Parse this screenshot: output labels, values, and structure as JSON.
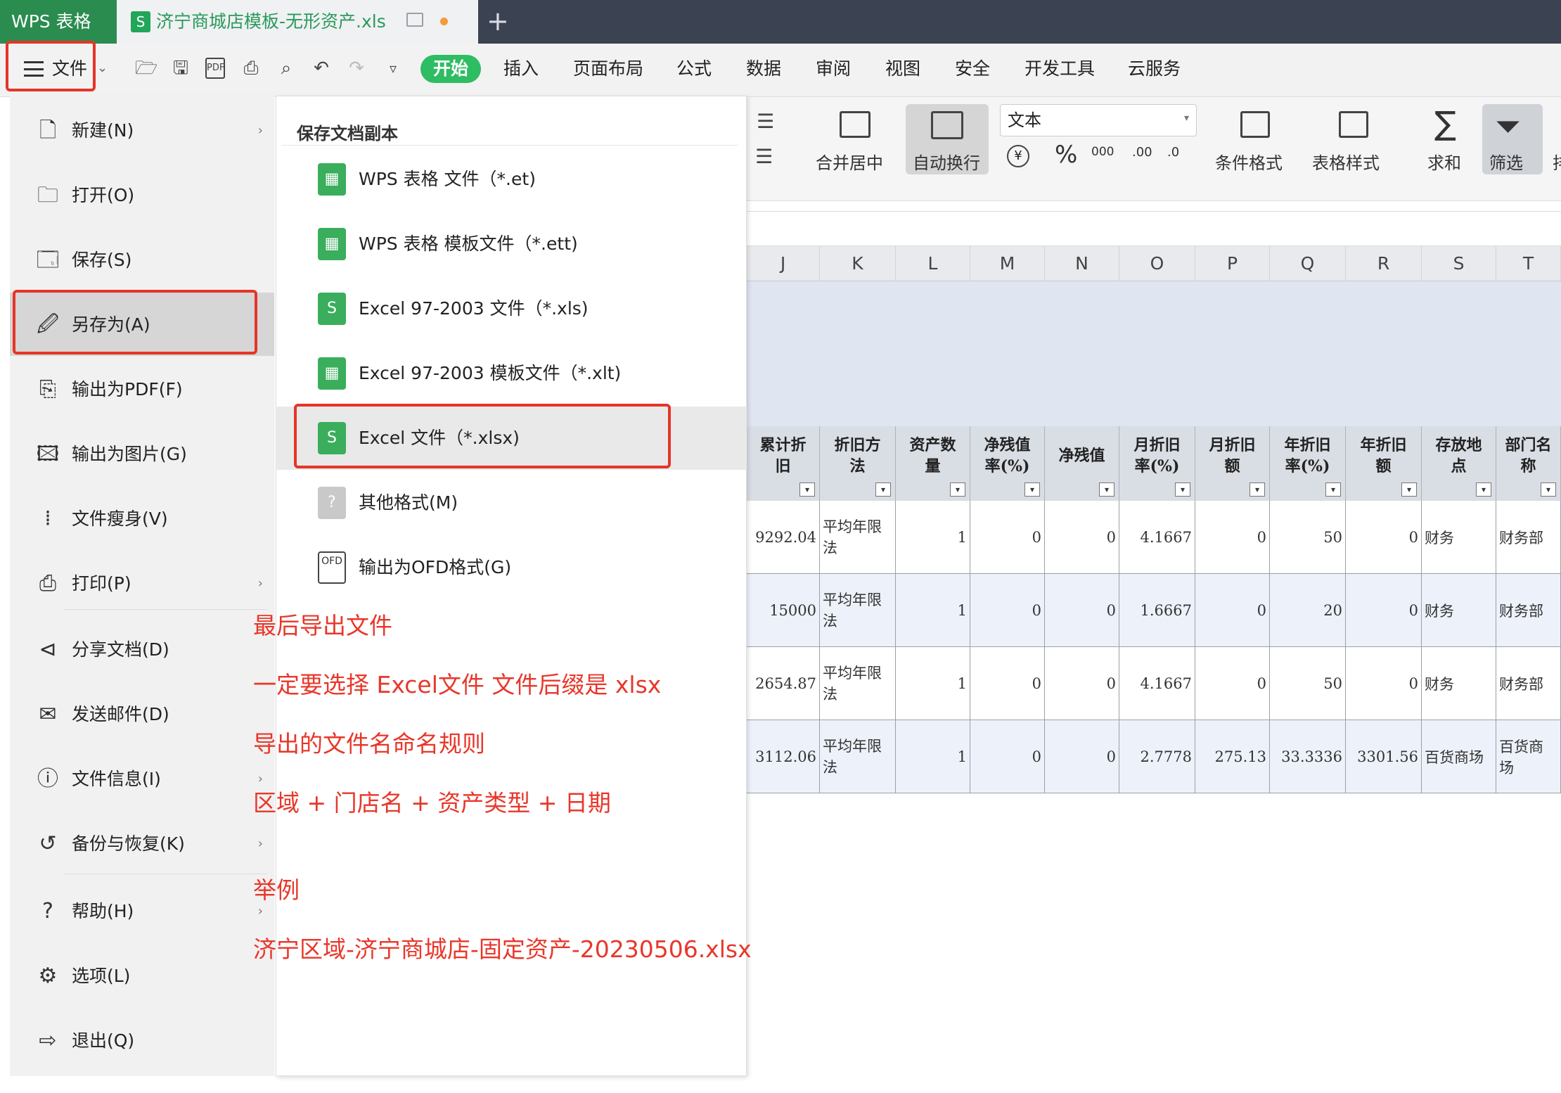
{
  "titlebar": {
    "app_name": "WPS 表格",
    "doc_title": "济宁商城店模板-无形资产.xls",
    "new_tab": "+"
  },
  "toolbar": {
    "file_button": "文件",
    "tabs": [
      "开始",
      "插入",
      "页面布局",
      "公式",
      "数据",
      "审阅",
      "视图",
      "安全",
      "开发工具",
      "云服务"
    ]
  },
  "ribbon": {
    "merge_center": "合并居中",
    "wrap_text": "自动换行",
    "number_format": "文本",
    "percent": "%",
    "thousands": "000",
    "cond_format": "条件格式",
    "table_style": "表格样式",
    "sum": "求和",
    "filter": "筛选",
    "cut_off": "排"
  },
  "file_menu": {
    "items": [
      {
        "label": "新建(N)",
        "arrow": "›"
      },
      {
        "label": "打开(O)",
        "arrow": ""
      },
      {
        "label": "保存(S)",
        "arrow": ""
      },
      {
        "label": "另存为(A)",
        "arrow": ""
      },
      {
        "label": "输出为PDF(F)",
        "arrow": ""
      },
      {
        "label": "输出为图片(G)",
        "arrow": ""
      },
      {
        "label": "文件瘦身(V)",
        "arrow": ""
      },
      {
        "label": "打印(P)",
        "arrow": "›"
      },
      {
        "label": "分享文档(D)",
        "arrow": ""
      },
      {
        "label": "发送邮件(D)",
        "arrow": ""
      },
      {
        "label": "文件信息(I)",
        "arrow": "›"
      },
      {
        "label": "备份与恢复(K)",
        "arrow": "›"
      },
      {
        "label": "帮助(H)",
        "arrow": "›"
      },
      {
        "label": "选项(L)",
        "arrow": ""
      },
      {
        "label": "退出(Q)",
        "arrow": ""
      }
    ]
  },
  "save_copy_panel": {
    "title": "保存文档副本",
    "items": [
      {
        "label": "WPS 表格 文件（*.et)",
        "icon": "grid-icon",
        "color": "#3aae5c"
      },
      {
        "label": "WPS 表格 模板文件（*.ett)",
        "icon": "grid-icon",
        "color": "#3aae5c"
      },
      {
        "label": "Excel 97-2003 文件（*.xls)",
        "icon": "s-icon",
        "color": "#3aae5c"
      },
      {
        "label": "Excel 97-2003 模板文件（*.xlt)",
        "icon": "grid-icon",
        "color": "#3aae5c"
      },
      {
        "label": "Excel 文件（*.xlsx)",
        "icon": "s-icon",
        "color": "#3aae5c"
      },
      {
        "label": "其他格式(M)",
        "icon": "question-icon",
        "color": "#c9c9c9"
      },
      {
        "label": "输出为OFD格式(G)",
        "icon": "ofd-icon",
        "color": "#ffffff"
      }
    ]
  },
  "annotations": [
    "最后导出文件",
    "一定要选择 Excel文件  文件后缀是 xlsx",
    "导出的文件名命名规则",
    "区域 + 门店名 + 资产类型 + 日期",
    "举例",
    "济宁区域-济宁商城店-固定资产-20230506.xlsx"
  ],
  "sheet": {
    "columns": [
      "J",
      "K",
      "L",
      "M",
      "N",
      "O",
      "P",
      "Q",
      "R",
      "S",
      "T"
    ],
    "headers": [
      [
        "累计折",
        "旧"
      ],
      [
        "折旧方",
        "法"
      ],
      [
        "资产数",
        "量"
      ],
      [
        "净残值",
        "率(%)"
      ],
      [
        "净残值",
        ""
      ],
      [
        "月折旧",
        "率(%)"
      ],
      [
        "月折旧",
        "额"
      ],
      [
        "年折旧",
        "率(%)"
      ],
      [
        "年折旧",
        "额"
      ],
      [
        "存放地",
        "点"
      ],
      [
        "部门名",
        "称"
      ]
    ],
    "rows": [
      [
        "9292.04",
        "平均年限法",
        "1",
        "0",
        "0",
        "4.1667",
        "0",
        "50",
        "0",
        "财务",
        "财务部"
      ],
      [
        "15000",
        "平均年限法",
        "1",
        "0",
        "0",
        "1.6667",
        "0",
        "20",
        "0",
        "财务",
        "财务部"
      ],
      [
        "2654.87",
        "平均年限法",
        "1",
        "0",
        "0",
        "4.1667",
        "0",
        "50",
        "0",
        "财务",
        "财务部"
      ],
      [
        "3112.06",
        "平均年限法",
        "1",
        "0",
        "0",
        "2.7778",
        "275.13",
        "33.3336",
        "3301.56",
        "百货商场",
        "百货商场"
      ]
    ]
  },
  "colors": {
    "titlebar_bg": "#3b4251",
    "app_tab_bg": "#2a8c4f",
    "start_tab_bg": "#2ebd62",
    "highlight_red": "#e53527",
    "annotation_red": "#e8372a"
  }
}
